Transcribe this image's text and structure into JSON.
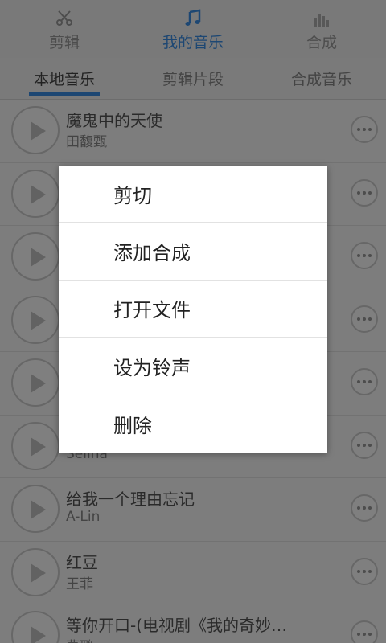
{
  "top_tabs": [
    {
      "label": "剪辑",
      "icon": "scissors-icon"
    },
    {
      "label": "我的音乐",
      "icon": "music-note-icon"
    },
    {
      "label": "合成",
      "icon": "equalizer-icon"
    }
  ],
  "sub_tabs": [
    {
      "label": "本地音乐"
    },
    {
      "label": "剪辑片段"
    },
    {
      "label": "合成音乐"
    }
  ],
  "songs": [
    {
      "title": "魔鬼中的天使",
      "artist": "田馥甄"
    },
    {
      "title": "",
      "artist": ""
    },
    {
      "title": "",
      "artist": ""
    },
    {
      "title": "",
      "artist": ""
    },
    {
      "title": "",
      "artist": ""
    },
    {
      "title": "",
      "artist": "Selina"
    },
    {
      "title": "给我一个理由忘记",
      "artist": "A-Lin"
    },
    {
      "title": "红豆",
      "artist": "王菲"
    },
    {
      "title": "等你开口-(电视剧《我的奇妙…",
      "artist": "曹璐"
    }
  ],
  "context_menu": {
    "items": [
      {
        "label": "剪切"
      },
      {
        "label": "添加合成"
      },
      {
        "label": "打开文件"
      },
      {
        "label": "设为铃声"
      },
      {
        "label": "删除"
      }
    ]
  },
  "colors": {
    "accent": "#3a8ee6",
    "overlay": "rgba(0,0,0,0.5)"
  }
}
